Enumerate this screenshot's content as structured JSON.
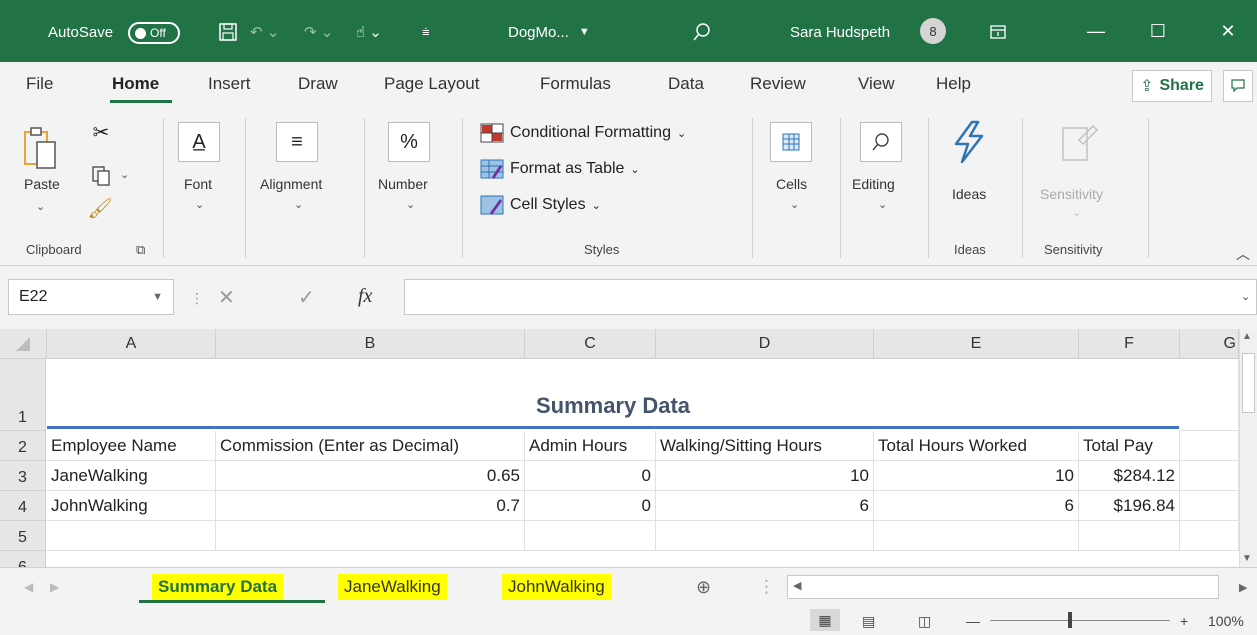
{
  "titlebar": {
    "autosave_label": "AutoSave",
    "autosave_state": "Off",
    "filename": "DogMo...",
    "user_name": "Sara Hudspeth",
    "avatar_initial": "8"
  },
  "ribbon_tabs": [
    "File",
    "Home",
    "Insert",
    "Draw",
    "Page Layout",
    "Formulas",
    "Data",
    "Review",
    "View",
    "Help"
  ],
  "share_label": "Share",
  "ribbon": {
    "paste": "Paste",
    "clipboard": "Clipboard",
    "font": "Font",
    "alignment": "Alignment",
    "number": "Number",
    "conditional_formatting": "Conditional Formatting",
    "format_as_table": "Format as Table",
    "cell_styles": "Cell Styles",
    "styles": "Styles",
    "cells": "Cells",
    "editing": "Editing",
    "ideas": "Ideas",
    "ideas_group": "Ideas",
    "sensitivity": "Sensitivity",
    "sensitivity_group": "Sensitivity"
  },
  "formula_bar": {
    "name_box": "E22",
    "fx": "fx",
    "value": ""
  },
  "columns": [
    "A",
    "B",
    "C",
    "D",
    "E",
    "F",
    "G"
  ],
  "rows": [
    "1",
    "2",
    "3",
    "4",
    "5",
    "6"
  ],
  "sheet": {
    "title": "Summary Data",
    "headers": [
      "Employee Name",
      "Commission (Enter as Decimal)",
      "Admin Hours",
      "Walking/Sitting Hours",
      "Total Hours Worked",
      "Total Pay"
    ],
    "data": [
      [
        "JaneWalking",
        "0.65",
        "0",
        "10",
        "10",
        "$284.12"
      ],
      [
        "JohnWalking",
        "0.7",
        "0",
        "6",
        "6",
        "$196.84"
      ]
    ]
  },
  "sheet_tabs": [
    "Summary Data",
    "JaneWalking",
    "JohnWalking"
  ],
  "status": {
    "zoom": "100%"
  },
  "colors": {
    "excel_green": "#217346",
    "title_text": "#44546a",
    "title_rule": "#4472c4",
    "tab_highlight": "#ffff00"
  }
}
